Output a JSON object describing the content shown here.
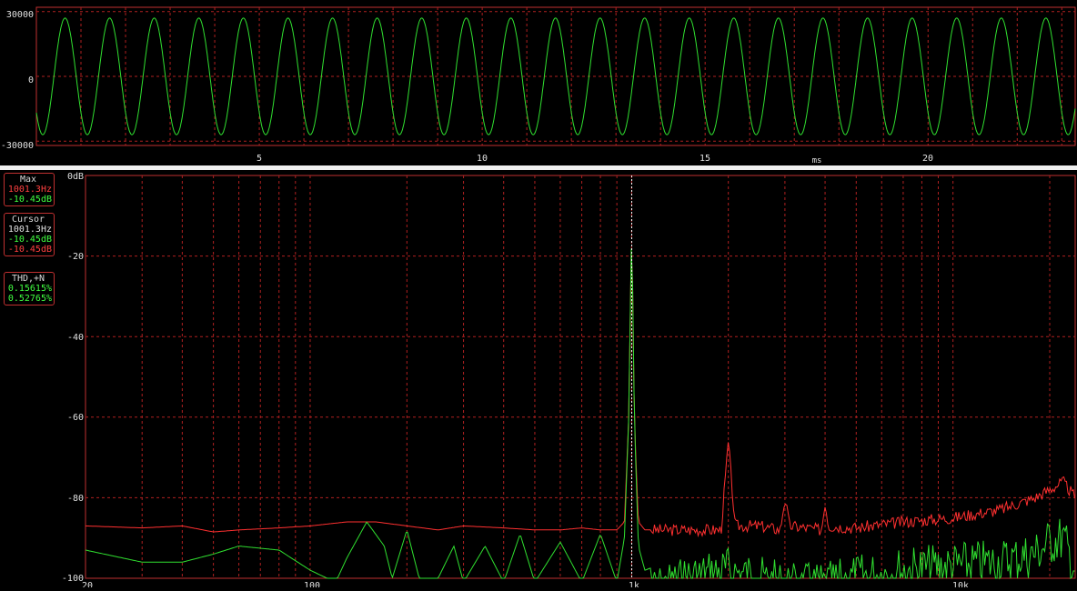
{
  "oscilloscope": {
    "y_ticks": [
      "30000",
      "0",
      "-30000"
    ],
    "x_ticks": [
      "5",
      "10",
      "15",
      "20"
    ],
    "x_unit": "ms"
  },
  "spectrum": {
    "y_ticks": [
      "0dB",
      "-20",
      "-40",
      "-60",
      "-80",
      "-100"
    ],
    "x_ticks": [
      "20",
      "100",
      "1k",
      "10k"
    ]
  },
  "max_box": {
    "title": "Max",
    "freq": "1001.3Hz",
    "level": "-10.45dB"
  },
  "cursor_box": {
    "title": "Cursor",
    "freq": "1001.3Hz",
    "level_green": "-10.45dB",
    "level_red": "-10.45dB"
  },
  "thd_box": {
    "title": "THD,+N",
    "thd": "0.15615%",
    "thdn": "0.52765%"
  },
  "colors": {
    "grid": "#b02020",
    "frame": "#c03030",
    "trace_green": "#30e030",
    "trace_red": "#ff3030",
    "cursor": "#ffffff"
  },
  "chart_data": [
    {
      "type": "line",
      "name": "oscilloscope",
      "x_unit": "ms",
      "xlim": [
        0,
        23.3
      ],
      "ylim": [
        -32000,
        32000
      ],
      "frequency_hz": 1000,
      "amplitude": 27000,
      "grid": true
    },
    {
      "type": "line",
      "name": "spectrum",
      "x_scale": "log",
      "xlim": [
        20,
        24000
      ],
      "ylim": [
        -100,
        0
      ],
      "grid": true,
      "cursor_freq_hz": 1001.3,
      "series": [
        {
          "color": "red",
          "x": [
            20,
            30,
            40,
            50,
            60,
            80,
            100,
            130,
            160,
            200,
            250,
            300,
            400,
            500,
            600,
            700,
            800,
            900,
            950,
            980,
            1001.3,
            1020,
            1050,
            1100,
            1500,
            1900,
            2000,
            2100,
            2500,
            2900,
            3000,
            3100,
            3500,
            3900,
            4000,
            4100,
            5000,
            7000,
            10000,
            14000,
            18000,
            20000,
            22000,
            24000
          ],
          "y": [
            -87,
            -87.5,
            -87,
            -88.5,
            -88,
            -87.5,
            -87,
            -86,
            -86,
            -87,
            -88,
            -87,
            -87.5,
            -88,
            -88,
            -87.5,
            -88,
            -88,
            -86,
            -60,
            -10.45,
            -60,
            -86,
            -88,
            -88,
            -88,
            -66,
            -87,
            -87,
            -88,
            -80,
            -87,
            -87.5,
            -88,
            -81,
            -87,
            -87.5,
            -86,
            -85,
            -83,
            -80,
            -78,
            -76,
            -80
          ]
        },
        {
          "color": "green",
          "x": [
            20,
            30,
            40,
            50,
            60,
            80,
            100,
            120,
            130,
            150,
            170,
            180,
            200,
            220,
            250,
            280,
            300,
            350,
            400,
            450,
            500,
            600,
            700,
            800,
            900,
            950,
            980,
            1001.3,
            1020,
            1050,
            1100,
            1500,
            2000,
            3000,
            4000,
            5000,
            7000,
            10000,
            14000,
            18000,
            20000,
            22000,
            24000
          ],
          "y": [
            -93,
            -96,
            -96,
            -94,
            -92,
            -93,
            -98,
            -101,
            -95,
            -86,
            -92,
            -100,
            -88,
            -101,
            -100,
            -92,
            -101,
            -92,
            -101,
            -89,
            -101,
            -91,
            -101,
            -89,
            -101,
            -90,
            -60,
            -10.45,
            -60,
            -92,
            -98,
            -94,
            -92,
            -96,
            -96,
            -94,
            -92,
            -91,
            -90,
            -88,
            -85,
            -84,
            -92
          ]
        }
      ]
    }
  ]
}
